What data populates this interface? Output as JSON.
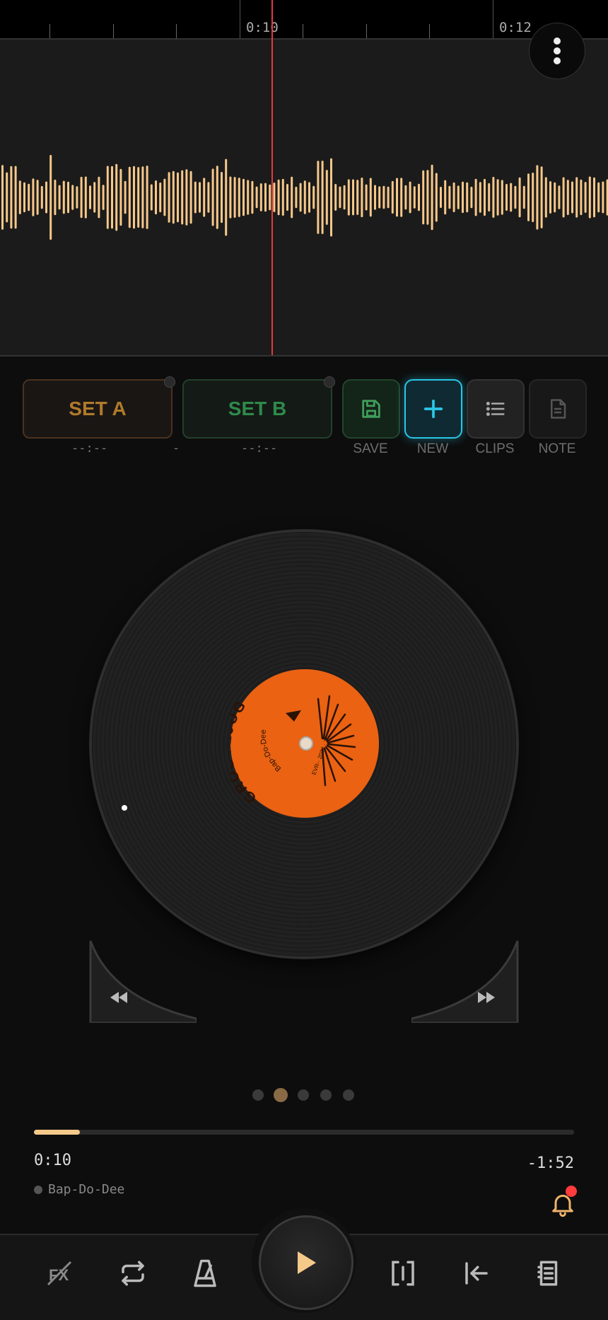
{
  "timeline": {
    "labels": [
      "0:10",
      "0:12"
    ]
  },
  "loop": {
    "set_a_label": "SET A",
    "set_b_label": "SET B",
    "a_time": "--:--",
    "separator": "-",
    "b_time": "--:--"
  },
  "actions": [
    {
      "label": "SAVE",
      "icon": "save-icon"
    },
    {
      "label": "NEW",
      "icon": "plus-icon"
    },
    {
      "label": "CLIPS",
      "icon": "list-icon"
    },
    {
      "label": "NOTE",
      "icon": "note-icon"
    }
  ],
  "record": {
    "brand": "GROOVEJOG",
    "title": "Bap-Do-Dee",
    "catalog": "EVR-· 2024 · 3"
  },
  "pager": {
    "count": 5,
    "active": 1
  },
  "playback": {
    "progress": 0.085,
    "elapsed": "0:10",
    "remaining": "-1:52",
    "track": "Bap-Do-Dee"
  },
  "colors": {
    "waveform": "#f7c88a",
    "playhead": "#e23b3b",
    "label": "#ea6212",
    "accent_new": "#29c6e6"
  }
}
